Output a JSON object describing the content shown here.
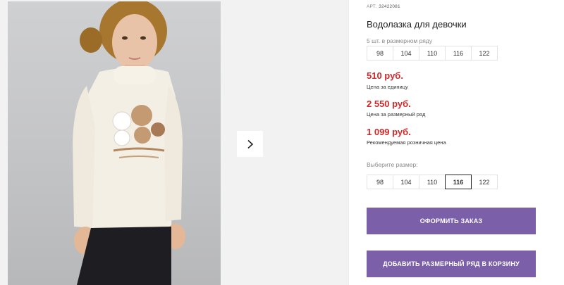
{
  "product": {
    "art_label": "АРТ.",
    "art_number": "32422081",
    "title": "Водолазка для девочки",
    "pack_label": "5 шт. в размерном ряду",
    "pack_sizes": [
      "98",
      "104",
      "110",
      "116",
      "122"
    ],
    "prices": [
      {
        "value": "510 руб.",
        "note": "Цена за единицу"
      },
      {
        "value": "2 550 руб.",
        "note": "Цена за размерный ряд"
      },
      {
        "value": "1 099 руб.",
        "note": "Рекомендуемая розничная цена"
      }
    ],
    "choose_label": "Выберите размер:",
    "choose_sizes": [
      "98",
      "104",
      "110",
      "116",
      "122"
    ],
    "selected_size": "116"
  },
  "buttons": {
    "order": "ОФОРМИТЬ ЗАКАЗ",
    "add_set": "ДОБАВИТЬ РАЗМЕРНЫЙ РЯД В КОРЗИНУ"
  },
  "gallery": {
    "next_icon": "chevron-right-icon"
  },
  "colors": {
    "accent": "#7b5fa8",
    "price": "#d1282b",
    "selected_border": "#222222"
  }
}
